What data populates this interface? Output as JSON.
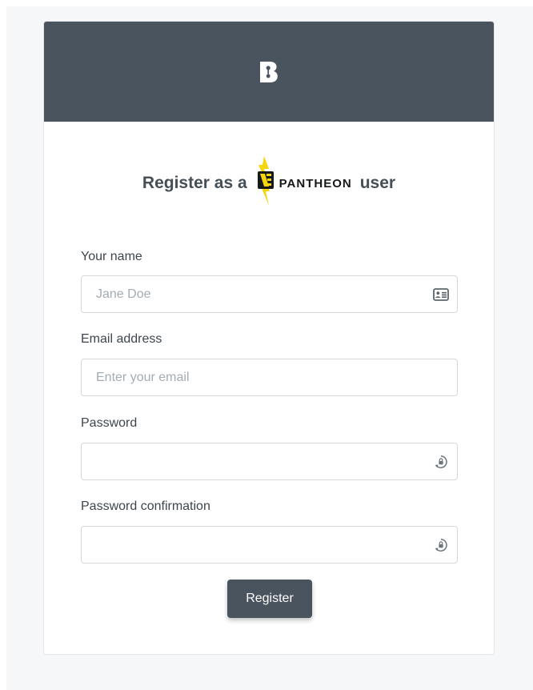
{
  "header": {
    "logo_icon": "b-logo-icon",
    "background_color": "#4a545e"
  },
  "heading": {
    "prefix": "Register as a",
    "brand_name": "PANTHEON",
    "brand_icon": "pantheon-bolt-icon",
    "suffix": "user"
  },
  "form": {
    "name": {
      "label": "Your name",
      "placeholder": "Jane Doe",
      "value": "",
      "icon": "id-card-icon"
    },
    "email": {
      "label": "Email address",
      "placeholder": "Enter your email",
      "value": ""
    },
    "password": {
      "label": "Password",
      "placeholder": "",
      "value": "",
      "icon": "password-reveal-icon"
    },
    "password_confirmation": {
      "label": "Password confirmation",
      "placeholder": "",
      "value": "",
      "icon": "password-reveal-icon"
    },
    "submit_label": "Register"
  },
  "colors": {
    "primary": "#4a545e",
    "brand_yellow": "#f5d50b"
  }
}
